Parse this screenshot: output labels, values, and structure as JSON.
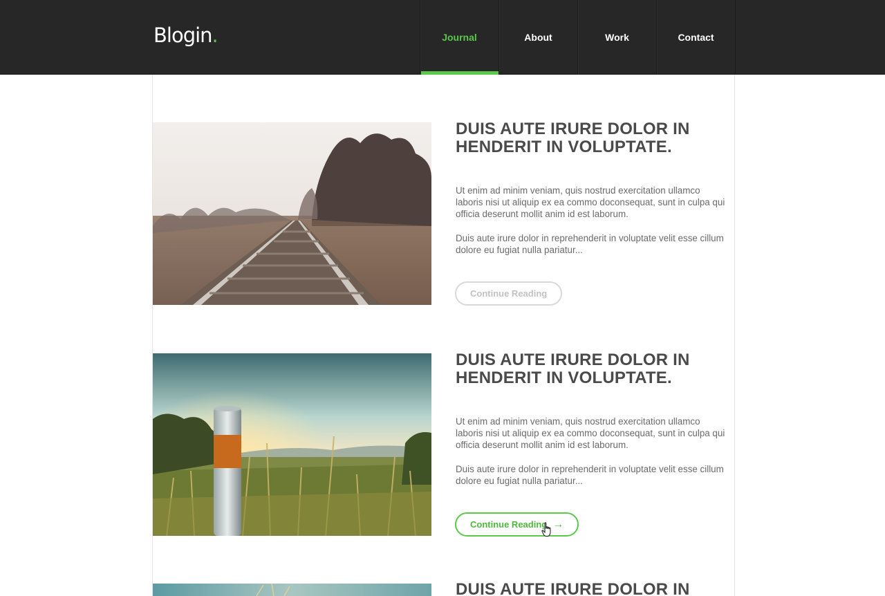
{
  "brand": {
    "name": "Blogin",
    "dot": ".",
    "accent": "#5bc84a"
  },
  "nav": {
    "items": [
      {
        "label": "Journal",
        "active": true
      },
      {
        "label": "About",
        "active": false
      },
      {
        "label": "Work",
        "active": false
      },
      {
        "label": "Contact",
        "active": false
      }
    ]
  },
  "posts": [
    {
      "title": "DUIS AUTE IRURE DOLOR IN HENDERIT IN VOLUPTATE.",
      "paragraph1": "Ut enim ad minim veniam, quis nostrud exercitation ullamco laboris nisi ut aliquip ex ea commo doconsequat, sunt in culpa qui officia deserunt mollit anim id est laborum.",
      "paragraph2": "Duis aute irure dolor in reprehenderit in voluptate velit esse cillum dolore eu fugiat nulla pariatur...",
      "button_label": "Continue Reading",
      "image": "railway-track-photo"
    },
    {
      "title": "DUIS AUTE IRURE DOLOR IN HENDERIT IN VOLUPTATE.",
      "paragraph1": "Ut enim ad minim veniam, quis nostrud exercitation ullamco laboris nisi ut aliquip ex ea commo doconsequat, sunt in culpa qui officia deserunt mollit anim id est laborum.",
      "paragraph2": "Duis aute irure dolor in reprehenderit in voluptate velit esse cillum dolore eu fugiat nulla pariatur...",
      "button_label": "Continue Reading",
      "button_arrow": "→",
      "image": "sunset-field-post-photo"
    },
    {
      "title": "DUIS AUTE IRURE DOLOR IN",
      "image": "grass-photo"
    }
  ]
}
